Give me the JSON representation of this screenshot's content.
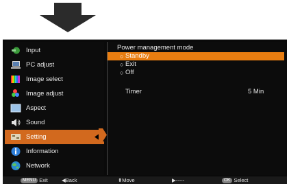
{
  "sidebar": {
    "items": [
      {
        "label": "Input",
        "icon": "input-icon"
      },
      {
        "label": "PC adjust",
        "icon": "pc-adjust-icon"
      },
      {
        "label": "Image select",
        "icon": "image-select-icon"
      },
      {
        "label": "Image adjust",
        "icon": "image-adjust-icon"
      },
      {
        "label": "Aspect",
        "icon": "aspect-icon"
      },
      {
        "label": "Sound",
        "icon": "sound-icon"
      },
      {
        "label": "Setting",
        "icon": "setting-icon",
        "selected": true
      },
      {
        "label": "Information",
        "icon": "information-icon"
      },
      {
        "label": "Network",
        "icon": "network-icon"
      }
    ]
  },
  "panel": {
    "title": "Power management mode",
    "options": [
      {
        "label": "Standby",
        "selected": true
      },
      {
        "label": "Exit"
      },
      {
        "label": "Off"
      }
    ],
    "timer_label": "Timer",
    "timer_value": "5 Min"
  },
  "statusbar": {
    "exit_key": "MENU",
    "exit_label": "Exit",
    "back_label": "Back",
    "move_label": "Move",
    "next_label": "-----",
    "select_key": "OK",
    "select_label": "Select"
  },
  "colors": {
    "selected_bg": "#d2691e",
    "option_highlight": "#e87d10",
    "menu_bg": "#0a0a0a"
  }
}
